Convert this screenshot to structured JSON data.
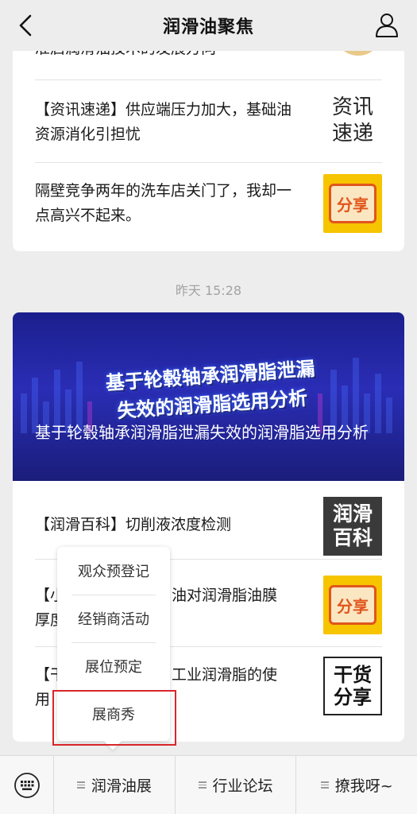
{
  "header": {
    "title": "润滑油聚焦"
  },
  "card1": {
    "top_partial_text": "准启润滑油技术的发展方向",
    "items": [
      {
        "text": "【资讯速递】供应端压力加大，基础油资源消化引担忧",
        "thumb_text": [
          "资讯",
          "速递"
        ]
      },
      {
        "text": "隔壁竞争两年的洗车店关门了，我却一点高兴不起来。",
        "thumb_text": "分享"
      }
    ]
  },
  "timestamp": "昨天 15:28",
  "card2": {
    "banner_title_lines": [
      "基于轮毂轴承润滑脂泄漏",
      "失效的润滑脂选用分析"
    ],
    "banner_caption": "基于轮毂轴承润滑脂泄漏失效的润滑脂选用分析",
    "items": [
      {
        "text": "【润滑百科】切削液浓度检测",
        "thumb_text": [
          "润滑",
          "百科"
        ]
      },
      {
        "text_left": "【小",
        "text_right": "油对润滑脂油膜",
        "text_line2": "厚度",
        "thumb_text": "分享"
      },
      {
        "text_left": "【干",
        "text_right": "工业润滑脂的使",
        "text_line2": "用",
        "thumb_text": [
          "干货",
          "分享"
        ]
      }
    ]
  },
  "popup_menu": {
    "items": [
      "观众预登记",
      "经销商活动",
      "展位预定",
      "展商秀"
    ]
  },
  "bottom_bar": {
    "menus": [
      "润滑油展",
      "行业论坛",
      "撩我呀~"
    ]
  },
  "colors": {
    "share_yellow": "#f7c400",
    "share_orange": "#e0561c",
    "banner_blue": "#2a2db5",
    "highlight_red": "#d8262a"
  }
}
